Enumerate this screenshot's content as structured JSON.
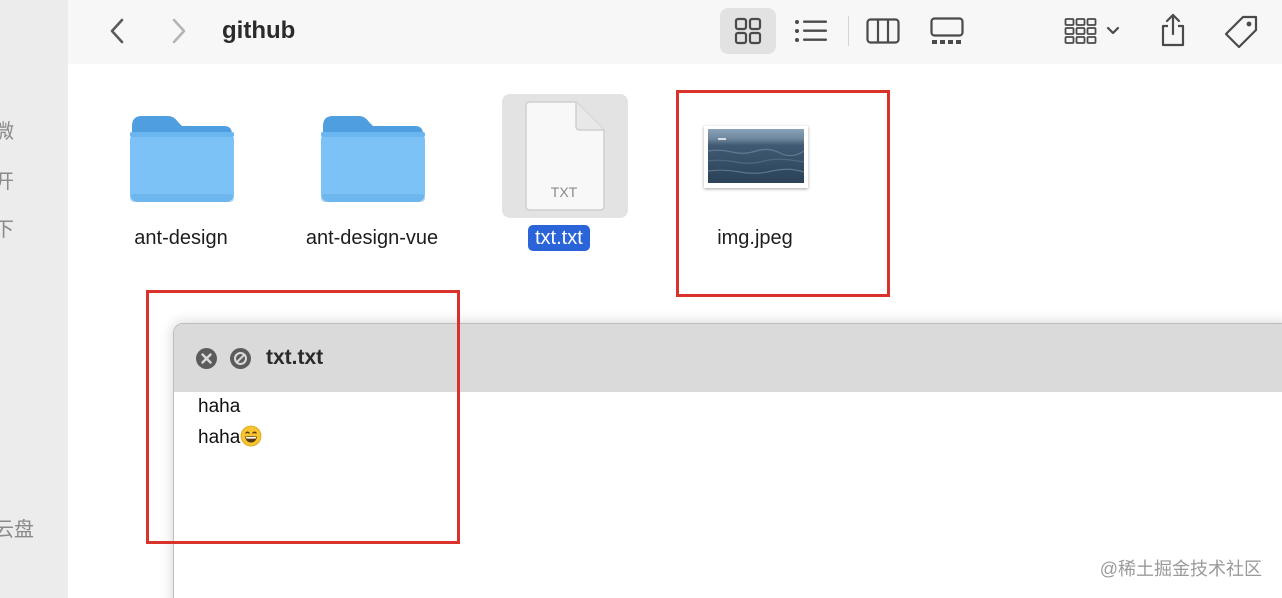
{
  "sidebar": {
    "fragments": [
      "微",
      "开",
      "下",
      "云盘"
    ]
  },
  "toolbar": {
    "title": "github",
    "back_icon": "chevron-left-icon",
    "forward_icon": "chevron-right-icon",
    "views": [
      "icon-view-icon",
      "list-view-icon",
      "column-view-icon",
      "gallery-view-icon"
    ],
    "group_icon": "group-by-icon",
    "share_icon": "share-icon",
    "tag_icon": "tag-icon"
  },
  "files": [
    {
      "name": "ant-design",
      "type": "folder"
    },
    {
      "name": "ant-design-vue",
      "type": "folder"
    },
    {
      "name": "txt.txt",
      "type": "text",
      "badge": "TXT",
      "selected": true
    },
    {
      "name": "img.jpeg",
      "type": "image"
    }
  ],
  "quicklook": {
    "title": "txt.txt",
    "lines": [
      "haha",
      "haha"
    ],
    "emoji": "😄"
  },
  "colors": {
    "annotation_red": "#d8322b",
    "folder_blue": "#6ab6f0",
    "selection_blue": "#2b64d9"
  },
  "watermark": "@稀土掘金技术社区"
}
